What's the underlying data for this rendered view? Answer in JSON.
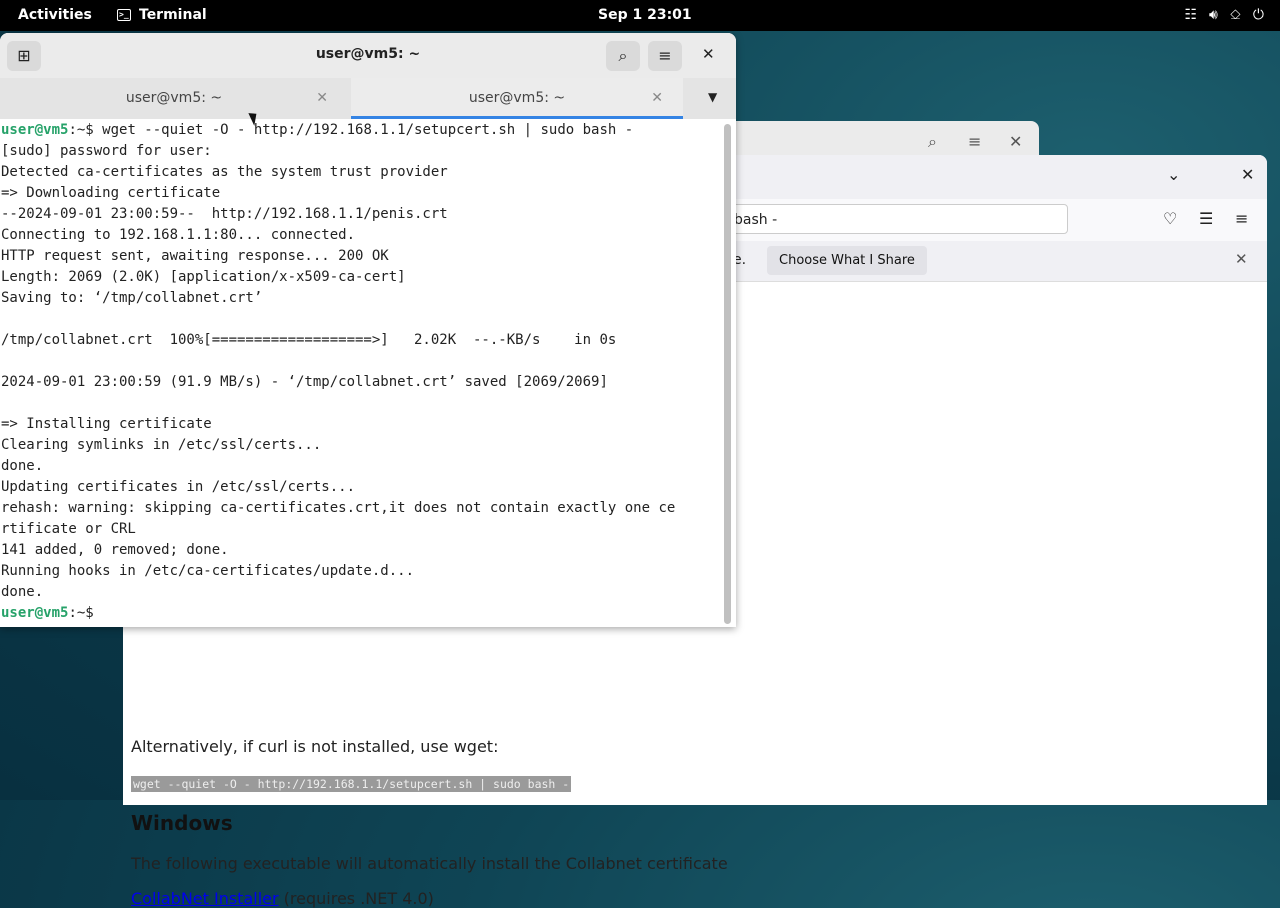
{
  "topbar": {
    "activities": "Activities",
    "app_name": "Terminal",
    "clock": "Sep 1  23:01",
    "tray_icons": [
      "network-icon",
      "volume-icon",
      "mic-icon",
      "power-icon"
    ]
  },
  "firefox": {
    "url_text": "bash -",
    "notification_text": "e.",
    "notification_button": "Choose What I Share",
    "cut_text": "Alternatively, if curl is not installed, use wget:",
    "code": "wget --quiet -O - http://192.168.1.1/setupcert.sh | sudo bash -",
    "heading": "Windows",
    "paragraph": "The following executable will automatically install the Collabnet certificate",
    "link": "CollabNet Installer",
    "link_note": " (requires .NET 4.0)"
  },
  "terminal": {
    "title": "user@vm5: ~",
    "tabs": [
      {
        "label": "user@vm5: ~",
        "active": false
      },
      {
        "label": "user@vm5: ~",
        "active": true
      }
    ],
    "prompt_user": "user@vm5",
    "prompt_suffix": ":~$",
    "command": " wget --quiet -O - http://192.168.1.1/setupcert.sh | sudo bash -",
    "output_lines": [
      "[sudo] password for user:",
      "Detected ca-certificates as the system trust provider",
      "=> Downloading certificate",
      "--2024-09-01 23:00:59--  http://192.168.1.1/penis.crt",
      "Connecting to 192.168.1.1:80... connected.",
      "HTTP request sent, awaiting response... 200 OK",
      "Length: 2069 (2.0K) [application/x-x509-ca-cert]",
      "Saving to: ‘/tmp/collabnet.crt’",
      "",
      "/tmp/collabnet.crt  100%[===================>]   2.02K  --.-KB/s    in 0s",
      "",
      "2024-09-01 23:00:59 (91.9 MB/s) - ‘/tmp/collabnet.crt’ saved [2069/2069]",
      "",
      "=> Installing certificate",
      "Clearing symlinks in /etc/ssl/certs...",
      "done.",
      "Updating certificates in /etc/ssl/certs...",
      "rehash: warning: skipping ca-certificates.crt,it does not contain exactly one ce",
      "rtificate or CRL",
      "141 added, 0 removed; done.",
      "Running hooks in /etc/ca-certificates/update.d...",
      "done."
    ]
  }
}
